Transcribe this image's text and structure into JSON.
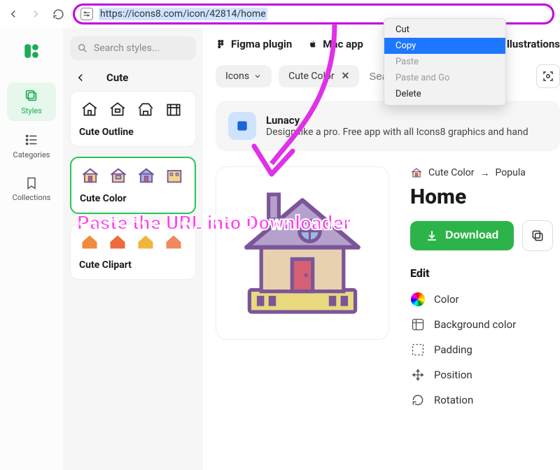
{
  "browser": {
    "url": "https://icons8.com/icon/42814/home",
    "context_menu": [
      "Cut",
      "Copy",
      "Paste",
      "Paste and Go",
      "Delete"
    ],
    "context_selected_index": 1,
    "context_disabled_indices": [
      2,
      3
    ]
  },
  "rail": {
    "items": [
      {
        "key": "styles",
        "label": "Styles"
      },
      {
        "key": "categories",
        "label": "Categories"
      },
      {
        "key": "collections",
        "label": "Collections"
      }
    ],
    "active_index": 0
  },
  "style_panel": {
    "search_placeholder": "Search styles...",
    "back_title": "Cute",
    "cards": [
      {
        "name": "Cute Outline",
        "active": false
      },
      {
        "name": "Cute Color",
        "active": true
      },
      {
        "name": "Cute Clipart",
        "active": false
      }
    ]
  },
  "topbar": {
    "figma": "Figma plugin",
    "mac": "Mac app",
    "illustrations": "Illustrations"
  },
  "filters": {
    "icons_label": "Icons",
    "active_filter": "Cute Color",
    "search_placeholder": "Search icons..."
  },
  "promo": {
    "title": "Lunacy",
    "body": "Design like a pro. Free app with all Icons8 graphics and hand"
  },
  "detail": {
    "breadcrumb_style": "Cute Color",
    "breadcrumb_next": "Popula",
    "icon_name": "Home",
    "download_label": "Download",
    "edit_header": "Edit",
    "edit_items": [
      "Color",
      "Background color",
      "Padding",
      "Position",
      "Rotation"
    ]
  },
  "overlay": {
    "instruction": "Paste the URL into Downloader"
  },
  "colors": {
    "accent_green": "#2cb44a",
    "annotation_magenta": "#c300e0"
  }
}
